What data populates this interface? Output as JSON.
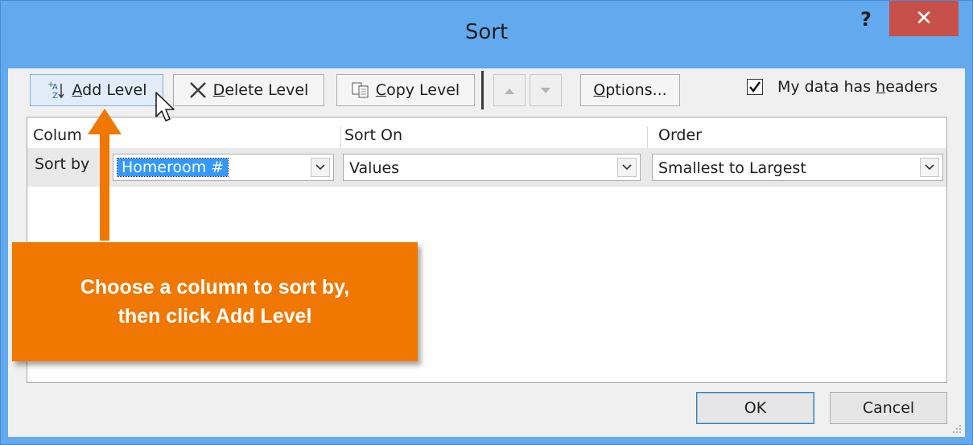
{
  "dialog": {
    "title": "Sort",
    "help": "?",
    "close": "✕"
  },
  "toolbar": {
    "add_level": {
      "pre": "",
      "accel": "A",
      "post": "dd Level"
    },
    "delete_level": {
      "pre": "",
      "accel": "D",
      "post": "elete Level"
    },
    "copy_level": {
      "pre": "",
      "accel": "C",
      "post": "opy Level"
    },
    "options": {
      "pre": "",
      "accel": "O",
      "post": "ptions..."
    },
    "headers_checkbox": {
      "pre": "My data has ",
      "accel": "h",
      "post": "eaders",
      "checked": true
    }
  },
  "grid": {
    "headers": [
      "Column",
      "Sort On",
      "Order"
    ],
    "column_header_visible": "Colum",
    "rows": [
      {
        "label": "Sort by",
        "column": "Homeroom #",
        "sort_on": "Values",
        "order": "Smallest to Largest"
      }
    ]
  },
  "buttons": {
    "ok": "OK",
    "cancel": "Cancel"
  },
  "callout": {
    "line1": "Choose a column to sort by,",
    "line2": "then click Add Level"
  },
  "colors": {
    "titlebar": "#63a9ee",
    "close": "#c7504a",
    "callout": "#f07800",
    "selection": "#3399ff"
  }
}
